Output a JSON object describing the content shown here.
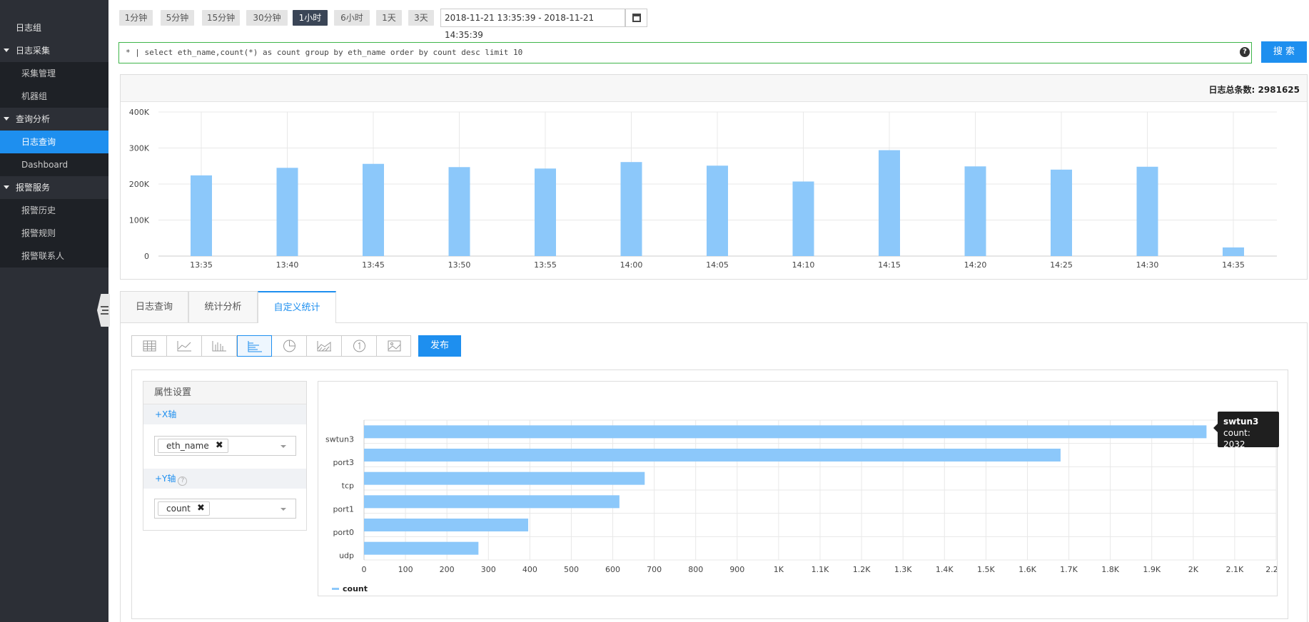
{
  "sidebar": {
    "top_item": "日志组",
    "groups": [
      {
        "label": "日志采集",
        "items": [
          "采集管理",
          "机器组"
        ]
      },
      {
        "label": "查询分析",
        "items": [
          "日志查询",
          "Dashboard"
        ]
      },
      {
        "label": "报警服务",
        "items": [
          "报警历史",
          "报警规则",
          "报警联系人"
        ]
      }
    ],
    "active_item": "日志查询"
  },
  "time_buttons": [
    "1分钟",
    "5分钟",
    "15分钟",
    "30分钟",
    "1小时",
    "6小时",
    "1天",
    "3天"
  ],
  "active_time_button": "1小时",
  "date_range": "2018-11-21 13:35:39 - 2018-11-21 14:35:39",
  "query": "* | select eth_name,count(*) as count group by eth_name order by count desc limit 10",
  "search_label": "搜 索",
  "histogram": {
    "total_label": "日志总条数:",
    "total_value": "2981625",
    "chart_data": {
      "type": "bar",
      "categories": [
        "13:35",
        "13:40",
        "13:45",
        "13:50",
        "13:55",
        "14:00",
        "14:05",
        "14:10",
        "14:15",
        "14:20",
        "14:25",
        "14:30",
        "14:35"
      ],
      "values": [
        224000,
        245000,
        256000,
        247000,
        243000,
        261000,
        251000,
        207000,
        294000,
        249000,
        240000,
        248000,
        24000
      ],
      "ylim": [
        0,
        400000
      ],
      "yticks": [
        "0",
        "100K",
        "200K",
        "300K",
        "400K"
      ],
      "color": "#8cc8fa"
    }
  },
  "tabs": [
    "日志查询",
    "统计分析",
    "自定义统计"
  ],
  "active_tab": "自定义统计",
  "chart_types": [
    "table-icon",
    "line-chart-icon",
    "column-chart-icon",
    "bar-chart-icon",
    "pie-chart-icon",
    "area-chart-icon",
    "single-value-icon",
    "map-icon"
  ],
  "active_chart_type": "bar-chart-icon",
  "publish_label": "发布",
  "attr_panel": {
    "title": "属性设置",
    "x_axis_label": "+X轴",
    "x_axis_value": "eth_name",
    "y_axis_label": "+Y轴",
    "y_axis_help": "?",
    "y_axis_value": "count"
  },
  "chart_data": {
    "type": "bar",
    "orientation": "horizontal",
    "categories": [
      "swtun3",
      "port3",
      "tcp",
      "port1",
      "port0",
      "udp"
    ],
    "series": [
      {
        "name": "count",
        "values": [
          2032,
          1680,
          677,
          616,
          396,
          276
        ]
      }
    ],
    "xlim": [
      0,
      2200
    ],
    "xticks": [
      "0",
      "100",
      "200",
      "300",
      "400",
      "500",
      "600",
      "700",
      "800",
      "900",
      "1K",
      "1.1K",
      "1.2K",
      "1.3K",
      "1.4K",
      "1.5K",
      "1.6K",
      "1.7K",
      "1.8K",
      "1.9K",
      "2K",
      "2.1K",
      "2.2"
    ],
    "legend": "bottom-left",
    "color": "#8cc8fa"
  },
  "tooltip": {
    "name": "swtun3",
    "text": "count: 2032"
  }
}
